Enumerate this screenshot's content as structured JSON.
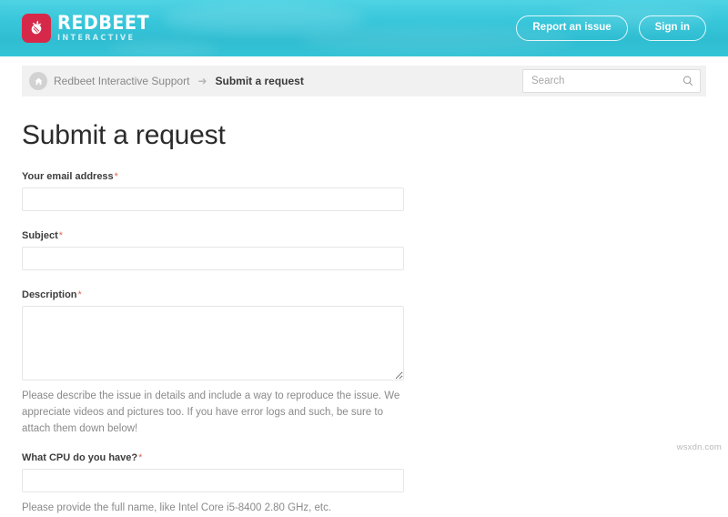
{
  "header": {
    "logo": {
      "name": "REDBEET",
      "subtitle": "INTERACTIVE",
      "mark_icon": "beet-icon",
      "mark_color": "#d6294a"
    },
    "report_issue_label": "Report an issue",
    "sign_in_label": "Sign in",
    "background_color": "#37c6da"
  },
  "subnav": {
    "home_icon": "home-icon",
    "breadcrumb": {
      "parent": "Redbeet Interactive Support",
      "separator": "➜",
      "current": "Submit a request"
    },
    "search": {
      "placeholder": "Search",
      "value": "",
      "icon": "search-icon"
    }
  },
  "main": {
    "page_title": "Submit a request",
    "required_marker": "*",
    "fields": [
      {
        "label": "Your email address",
        "required": true,
        "type": "text",
        "value": "",
        "help": ""
      },
      {
        "label": "Subject",
        "required": true,
        "type": "text",
        "value": "",
        "help": ""
      },
      {
        "label": "Description",
        "required": true,
        "type": "textarea",
        "value": "",
        "help": "Please describe the issue in details and include a way to reproduce the issue. We appreciate videos and pictures too. If you have error logs and such, be sure to attach them down below!"
      },
      {
        "label": "What CPU do you have?",
        "required": true,
        "type": "text",
        "value": "",
        "help": "Please provide the full name, like Intel Core i5-8400 2.80 GHz, etc."
      }
    ]
  },
  "watermark": "wsxdn.com"
}
